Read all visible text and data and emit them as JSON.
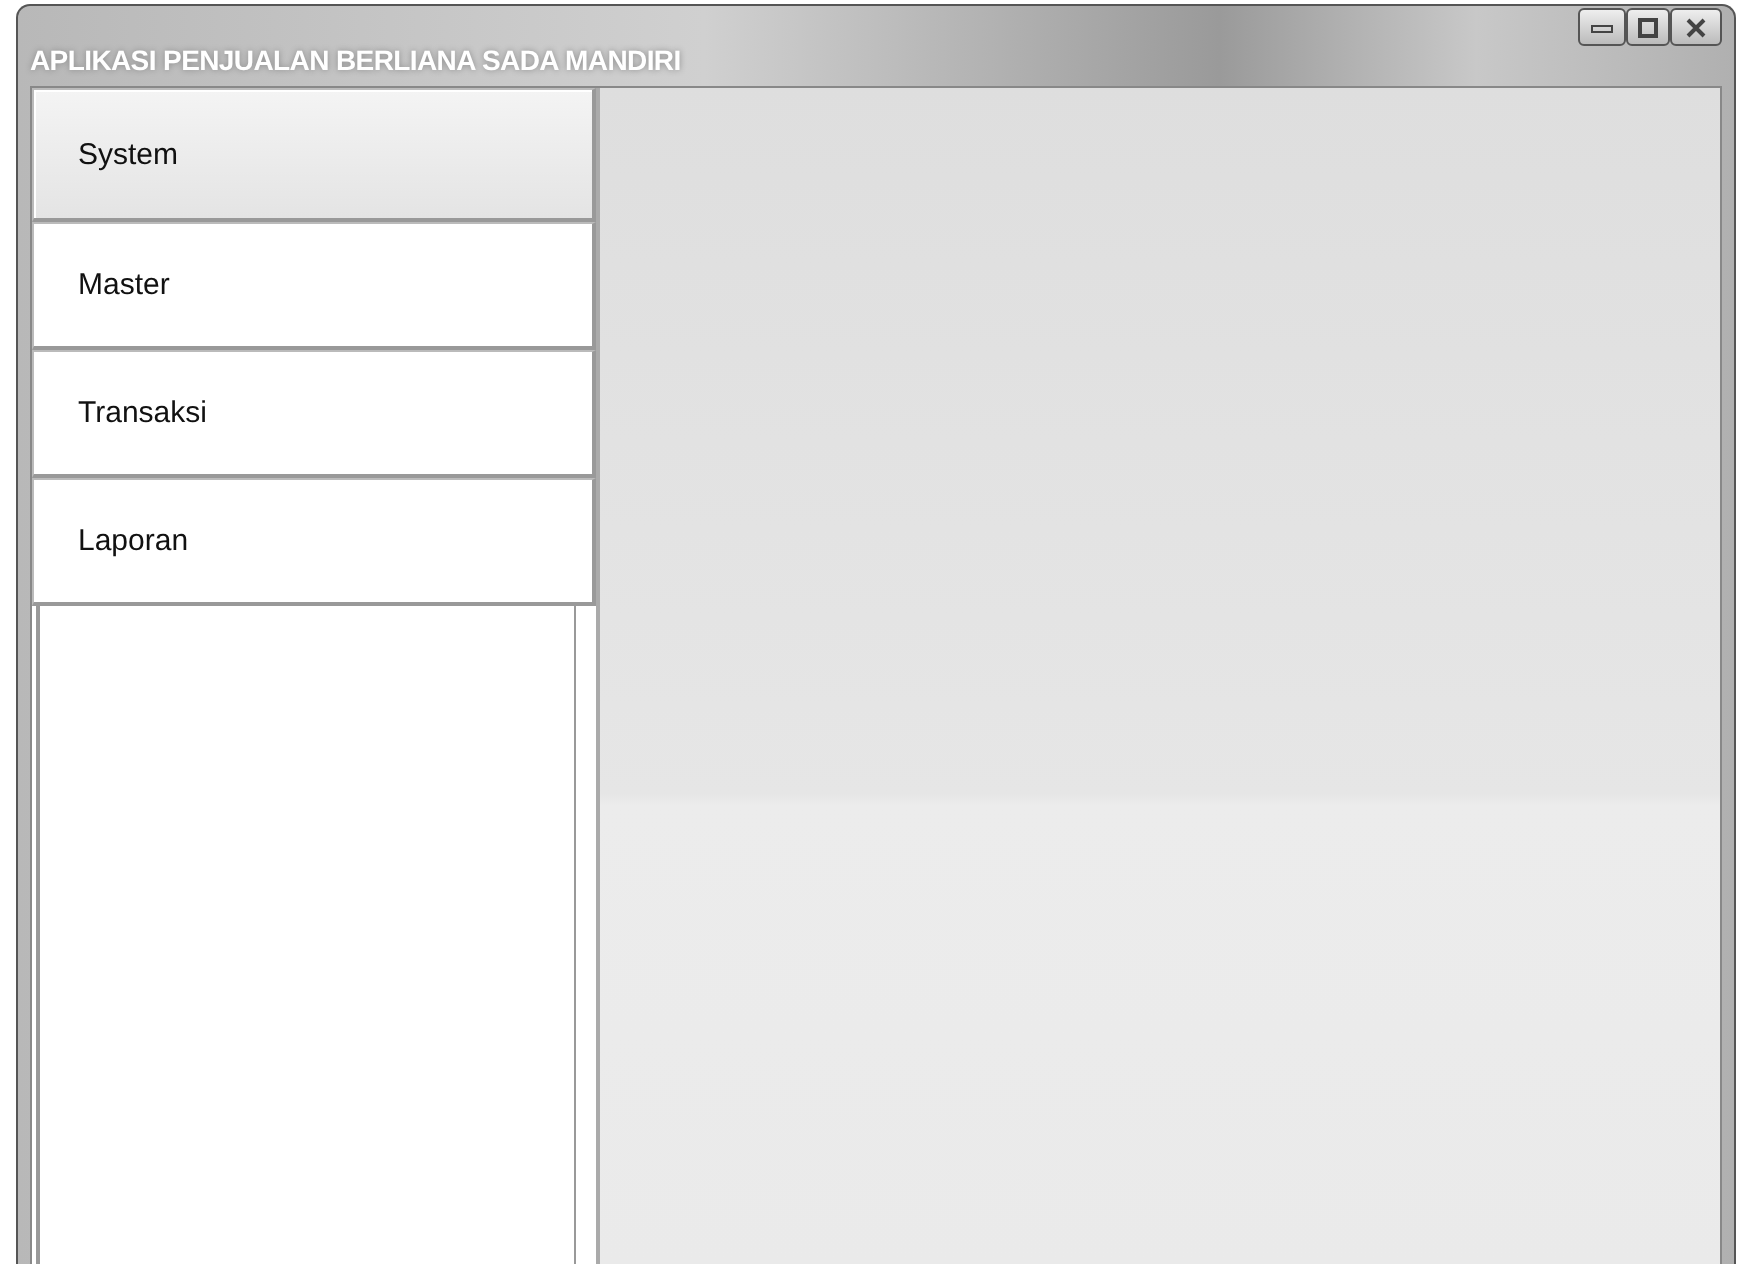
{
  "window": {
    "title": "APLIKASI PENJUALAN BERLIANA SADA MANDIRI"
  },
  "menu": [
    {
      "label": "System",
      "selected": true
    },
    {
      "label": "Master",
      "selected": false
    },
    {
      "label": "Transaksi",
      "selected": false
    },
    {
      "label": "Laporan",
      "selected": false
    }
  ]
}
